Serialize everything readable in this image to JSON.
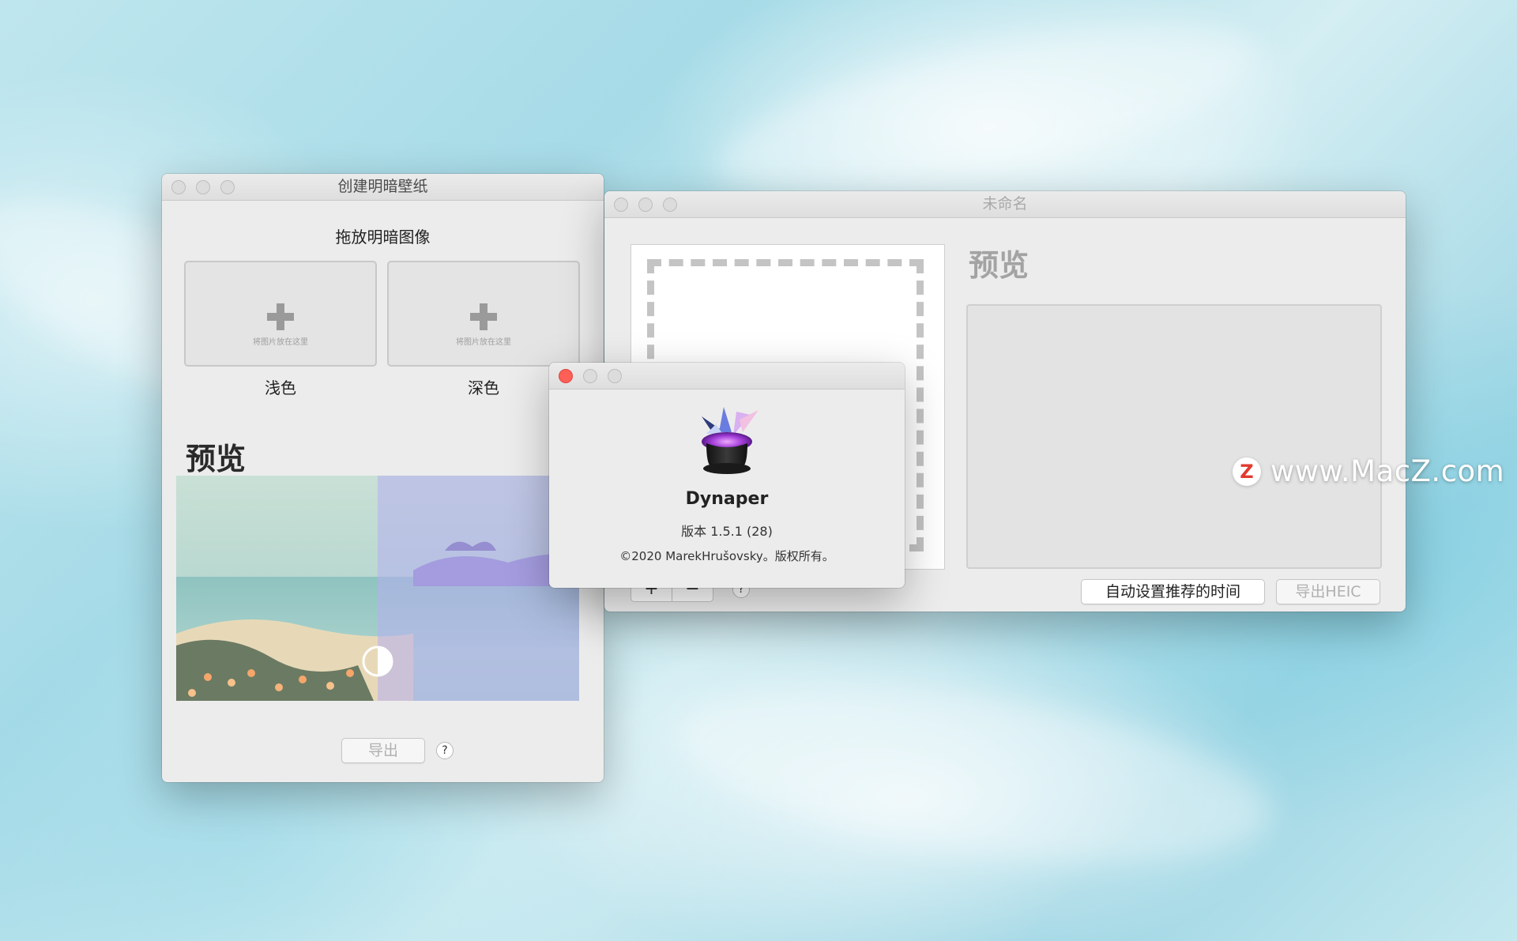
{
  "colors": {
    "close_red": "#fe5f57",
    "window_bg": "#ececec"
  },
  "create_window": {
    "title": "创建明暗壁纸",
    "drop_title": "拖放明暗图像",
    "wells": [
      {
        "label": "浅色",
        "hint": "将图片放在这里"
      },
      {
        "label": "深色",
        "hint": "将图片放在这里"
      }
    ],
    "preview_title": "预览",
    "export_label": "导出",
    "help_label": "?"
  },
  "doc_window": {
    "title": "未命名",
    "preview_title": "预览",
    "add_label": "+",
    "remove_label": "−",
    "help_label": "?",
    "auto_time_label": "自动设置推荐的时间",
    "export_heic_label": "导出HEIC"
  },
  "about_window": {
    "app_name": "Dynaper",
    "version": "版本 1.5.1 (28)",
    "copyright": "©2020 MarekHrušovsky。版权所有。"
  },
  "watermark": {
    "text": "www.MacZ.com",
    "logo_letter": "Z"
  }
}
